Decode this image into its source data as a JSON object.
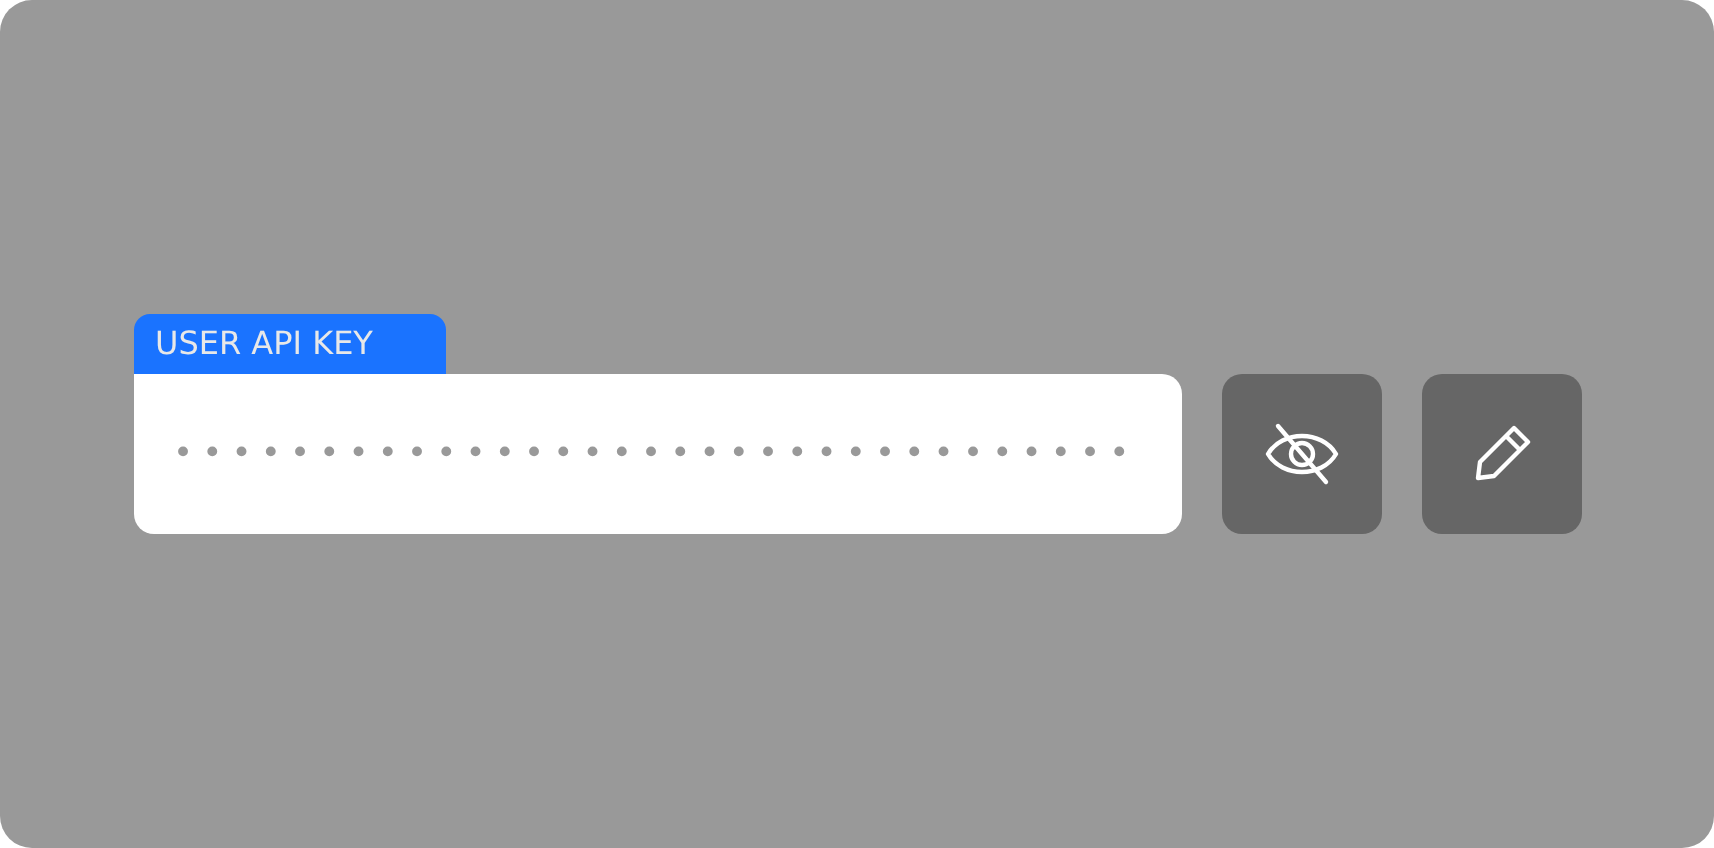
{
  "api_key": {
    "label": "USER API KEY",
    "value": "•••••••••••••••••••••••••••••••••",
    "revealed": false
  },
  "buttons": [
    {
      "kind": "visibility"
    },
    {
      "kind": "edit"
    }
  ]
}
